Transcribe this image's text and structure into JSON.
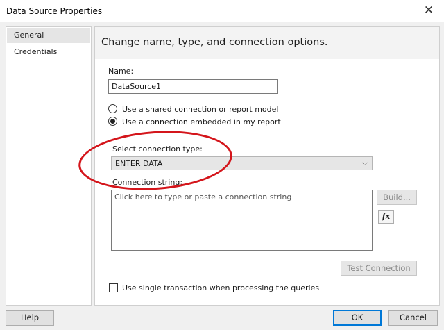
{
  "window": {
    "title": "Data Source Properties",
    "close_glyph": "✕"
  },
  "nav": {
    "items": [
      {
        "label": "General"
      },
      {
        "label": "Credentials"
      }
    ]
  },
  "panel": {
    "heading": "Change name, type, and connection options.",
    "name_label": "Name:",
    "name_value": "DataSource1",
    "radio_shared": "Use a shared connection or report model",
    "radio_embedded": "Use a connection embedded in my report",
    "connection_type_label": "Select connection type:",
    "connection_type_value": "ENTER DATA",
    "connection_string_label": "Connection string:",
    "connection_string_placeholder": "Click here to type or paste a connection string",
    "build_button": "Build...",
    "fx_button": "fx",
    "test_connection_button": "Test Connection",
    "single_transaction_label": "Use single transaction when processing the queries"
  },
  "footer": {
    "help": "Help",
    "ok": "OK",
    "cancel": "Cancel"
  },
  "colors": {
    "annotation": "#d4151b",
    "accent": "#0078d7"
  },
  "state": {
    "selected_radio": "embedded",
    "single_transaction_checked": false
  }
}
